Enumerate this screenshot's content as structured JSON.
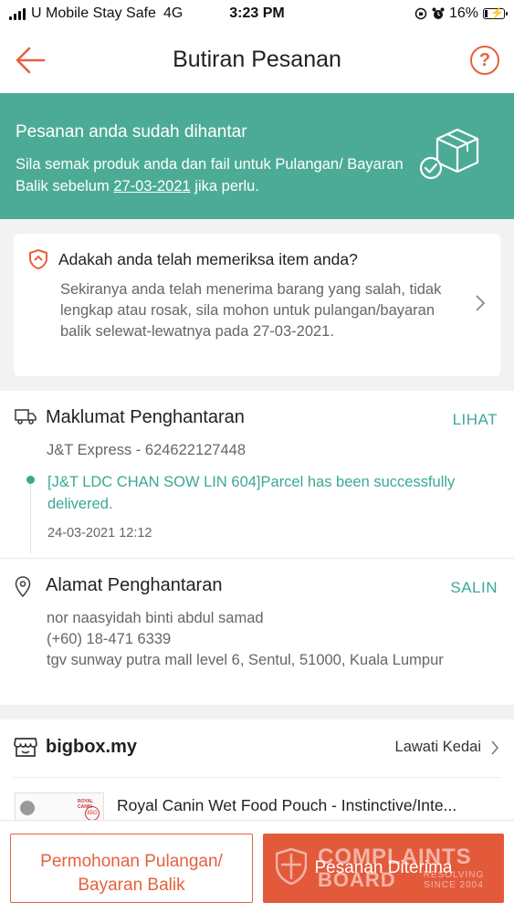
{
  "status_bar": {
    "carrier": "U Mobile Stay Safe",
    "network": "4G",
    "time": "3:23 PM",
    "battery": "16%",
    "battery_level": 0.16
  },
  "nav": {
    "title": "Butiran Pesanan",
    "help_label": "?"
  },
  "banner": {
    "title": "Pesanan anda sudah dihantar",
    "desc_before": "Sila semak produk anda dan fail untuk Pulangan/ Bayaran Balik sebelum ",
    "desc_date": "27-03-2021",
    "desc_after": " jika perlu.",
    "color": "#4cab96"
  },
  "check_card": {
    "title": "Adakah anda telah memeriksa item anda?",
    "desc": "Sekiranya anda telah menerima barang yang salah, tidak lengkap atau rosak, sila mohon untuk pulangan/bayaran balik selewat-lewatnya pada 27-03-2021."
  },
  "delivery": {
    "title": "Maklumat Penghantaran",
    "action": "LIHAT",
    "courier": "J&T Express - 624622127448",
    "status": "[J&T LDC CHAN SOW LIN 604]Parcel has been successfully delivered.",
    "time": "24-03-2021 12:12"
  },
  "address": {
    "title": "Alamat Penghantaran",
    "action": "SALIN",
    "name": "nor naasyidah binti abdul samad",
    "phone": "(+60) 18-471 6339",
    "street": "tgv sunway putra mall level 6, Sentul, 51000, Kuala Lumpur"
  },
  "shop": {
    "name": "bigbox.my",
    "visit": "Lawati Kedai",
    "product_name": "Royal Canin Wet Food Pouch - Instinctive/Inte...",
    "thumb_brand": "ROYAL CANIN",
    "thumb_weight": "85G"
  },
  "bottom": {
    "return_button": "Permohonan Pulangan/ Bayaran Balik",
    "received_button": "Pesanan Diterima",
    "watermark_line1": "COMPLAINTS",
    "watermark_line2": "BOARD",
    "watermark_line3": "RESOLVING SINCE 2004"
  },
  "colors": {
    "accent": "#e5613d",
    "teal": "#3aa894"
  }
}
